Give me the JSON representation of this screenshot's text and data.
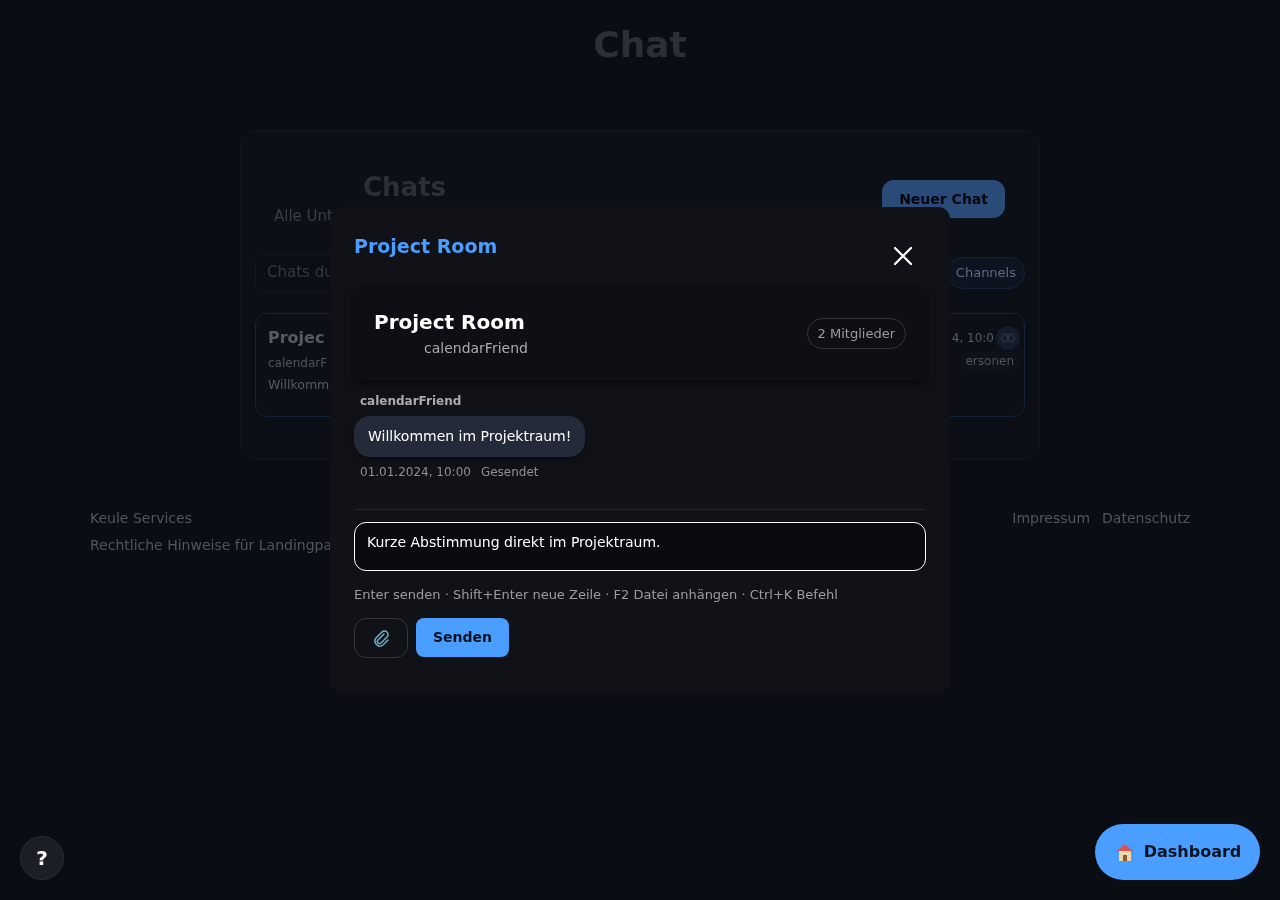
{
  "page": {
    "title": "Chat"
  },
  "chats_card": {
    "heading": "Chats",
    "subtitle": "Alle Unt",
    "new_chat_button": "Neuer Chat",
    "search": {
      "placeholder": "Chats du"
    },
    "filter_chip": "Channels",
    "chat_item": {
      "title": "Projec",
      "sender": "calendarF",
      "preview": "Willkomm",
      "time": "4, 10:0",
      "members": "ersonen"
    }
  },
  "footer": {
    "brand": "Keule Services",
    "legal": "Rechtliche Hinweise für Landingpa",
    "links": [
      "Impressum",
      "Datenschutz"
    ]
  },
  "modal": {
    "title": "Project Room",
    "room": {
      "name": "Project Room",
      "owner": "calendarFriend",
      "members_badge": "2 Mitglieder"
    },
    "messages": [
      {
        "sender": "calendarFriend",
        "text": "Willkommen im Projektraum!",
        "time": "01.01.2024, 10:00",
        "status": "Gesendet"
      }
    ],
    "composer": {
      "value": "Kurze Abstimmung direkt im Projektraum.",
      "hint": "Enter senden · Shift+Enter neue Zeile · F2 Datei anhängen · Ctrl+K Befehl",
      "send_button": "Senden"
    }
  },
  "help_button": "?",
  "dashboard_button": "Dashboard"
}
